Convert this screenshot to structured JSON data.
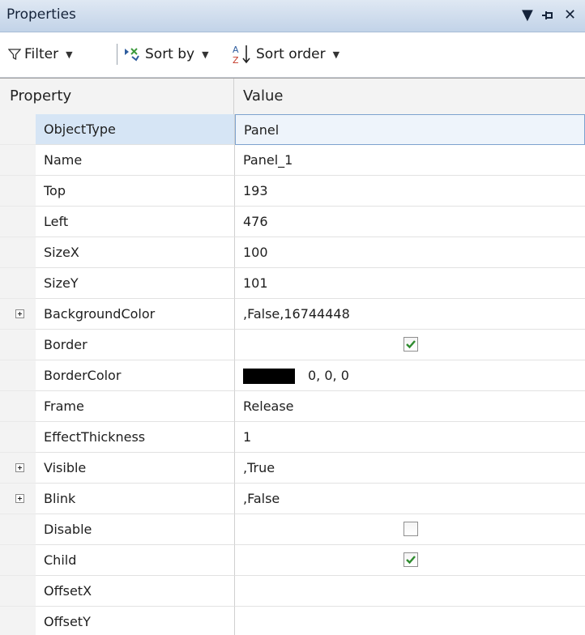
{
  "window": {
    "title": "Properties"
  },
  "toolbar": {
    "filter_label": "Filter",
    "sortby_label": "Sort by",
    "sortorder_label": "Sort order"
  },
  "grid": {
    "headers": {
      "property": "Property",
      "value": "Value"
    },
    "rows": [
      {
        "name": "ObjectType",
        "value": "Panel",
        "selected": true
      },
      {
        "name": "Name",
        "value": "Panel_1"
      },
      {
        "name": "Top",
        "value": "193"
      },
      {
        "name": "Left",
        "value": "476"
      },
      {
        "name": "SizeX",
        "value": "100"
      },
      {
        "name": "SizeY",
        "value": "101"
      },
      {
        "name": "BackgroundColor",
        "value": ",False,16744448",
        "expandable": true
      },
      {
        "name": "Border",
        "checked": true
      },
      {
        "name": "BorderColor",
        "value": "0, 0, 0",
        "swatch": "#000000"
      },
      {
        "name": "Frame",
        "value": "Release"
      },
      {
        "name": "EffectThickness",
        "value": "1"
      },
      {
        "name": "Visible",
        "value": ",True",
        "expandable": true
      },
      {
        "name": "Blink",
        "value": ",False",
        "expandable": true
      },
      {
        "name": "Disable",
        "checked": false
      },
      {
        "name": "Child",
        "checked": true
      },
      {
        "name": "OffsetX",
        "value": ""
      },
      {
        "name": "OffsetY",
        "value": ""
      }
    ]
  },
  "colors": {
    "selection": "#d6e5f5",
    "titlebar": "#c2d3e8",
    "check": "#2e8b2e"
  }
}
